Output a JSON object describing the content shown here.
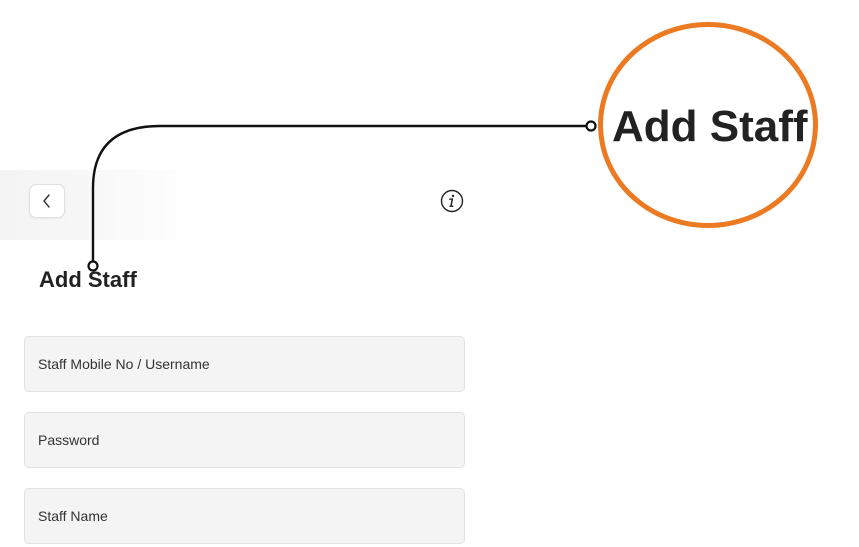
{
  "header": {
    "back_icon": "chevron-left-icon",
    "info_icon": "info-icon"
  },
  "page": {
    "title": "Add Staff"
  },
  "form": {
    "fields": [
      {
        "placeholder": "Staff Mobile No / Username"
      },
      {
        "placeholder": "Password"
      },
      {
        "placeholder": "Staff Name"
      }
    ]
  },
  "callout": {
    "zoom_text": "Add Staff",
    "ring_color": "#ec7a22"
  }
}
